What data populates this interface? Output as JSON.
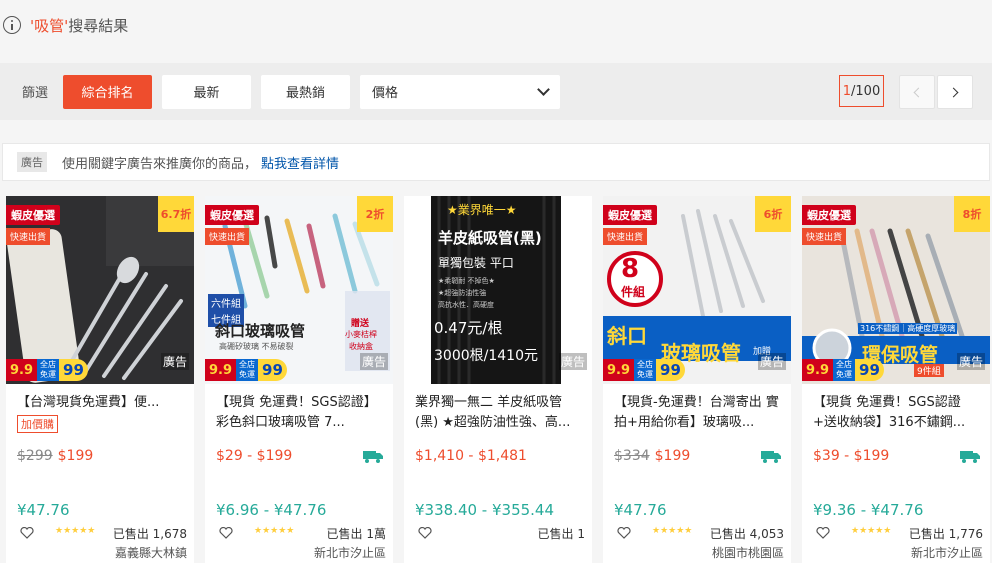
{
  "header": {
    "keyword": "'吸管'",
    "suffix": "搜尋結果"
  },
  "filter": {
    "label": "篩選",
    "sort_options": [
      "綜合排名",
      "最新",
      "最熱銷"
    ],
    "active_sort": "綜合排名",
    "price_label": "價格",
    "page_current": "1",
    "page_total": "/100"
  },
  "ad_notice": {
    "tag": "廣告",
    "text": "使用關鍵字廣告來推廣你的商品，",
    "link": "點我查看詳情"
  },
  "products": [
    {
      "mall_badge": "蝦皮優選",
      "fast_badge": "快速出貨",
      "discount": "6.7折",
      "ad": "廣告",
      "promo_99": "9.9",
      "promo_mid_1": "全店",
      "promo_mid_2": "免運",
      "promo_big": "99",
      "title": "【台灣現貨免運費】便...",
      "extra_tag": "加價購",
      "orig_price": "$299",
      "price": "$199",
      "ref_price": "¥47.76",
      "stars": "★★★★★",
      "sold": "已售出 1,678",
      "location": "嘉義縣大林鎮"
    },
    {
      "mall_badge": "蝦皮優選",
      "fast_badge": "快速出貨",
      "discount": "2折",
      "ad": "廣告",
      "promo_99": "9.9",
      "promo_mid_1": "全店",
      "promo_mid_2": "免運",
      "promo_big": "99",
      "title": "【現貨 免運費！SGS認證】彩色斜口玻璃吸管 7...",
      "thumb_text_1": "六件組",
      "thumb_text_2": "七件組",
      "thumb_text_3": "斜口玻璃吸管",
      "thumb_text_4": "高硼矽玻璃 不易破裂",
      "thumb_text_5": "贈送",
      "thumb_text_6": "小麥桔桿",
      "thumb_text_7": "收納盒",
      "orig_price": "",
      "price": "$29 - $199",
      "ref_price": "¥6.96 - ¥47.76",
      "stars": "★★★★★",
      "sold": "已售出 1萬",
      "location": "新北市汐止區"
    },
    {
      "ad": "廣告",
      "thumb_line_1": "★業界唯一★",
      "thumb_line_2": "羊皮紙吸管(黑)",
      "thumb_line_3": "單獨包裝 平口",
      "thumb_line_4": "★柔韌耐 不掉色★",
      "thumb_line_5": "★超強防油性強",
      "thumb_line_6": "高抗水性．高硬度",
      "thumb_line_7": "0.47元/根",
      "thumb_line_8": "3000根/1410元",
      "title": "業界獨一無二 羊皮紙吸管(黑) ★超強防油性強、高...",
      "orig_price": "",
      "price": "$1,410 - $1,481",
      "ref_price": "¥338.40 - ¥355.44",
      "stars": "",
      "sold": "已售出 1",
      "location": ""
    },
    {
      "mall_badge": "蝦皮優選",
      "fast_badge": "快速出貨",
      "discount": "6折",
      "ad": "廣告",
      "promo_99": "9.9",
      "promo_mid_1": "全店",
      "promo_mid_2": "免運",
      "promo_big": "99",
      "thumb_text_1": "8",
      "thumb_text_2": "件組",
      "thumb_text_3": "斜口",
      "thumb_text_4": "玻璃吸管",
      "thumb_text_5": "加贈",
      "title": "【現貨-免運費！台灣寄出 實拍+用給你看】玻璃吸...",
      "orig_price": "$334",
      "price": "$199",
      "ref_price": "¥47.76",
      "stars": "★★★★★",
      "sold": "已售出 4,053",
      "location": "桃園市桃園區"
    },
    {
      "mall_badge": "蝦皮優選",
      "fast_badge": "快速出貨",
      "discount": "8折",
      "ad": "廣告",
      "promo_99": "9.9",
      "promo_mid_1": "全店",
      "promo_mid_2": "免運",
      "promo_big": "99",
      "thumb_text_1": "316不鏽鋼｜高硬度厚玻璃",
      "thumb_text_2": "環保吸管",
      "thumb_text_3": "9件組",
      "title": "【現貨 免運費！SGS認證+送收納袋】316不鏽鋼...",
      "orig_price": "",
      "price": "$39 - $199",
      "ref_price": "¥9.36 - ¥47.76",
      "stars": "★★★★★",
      "sold": "已售出 1,776",
      "location": "新北市汐止區"
    }
  ],
  "colors": {
    "brand": "#ee4d2d",
    "mall_red": "#d0011b",
    "ref_green": "#26aa99",
    "link_blue": "#0055aa"
  }
}
